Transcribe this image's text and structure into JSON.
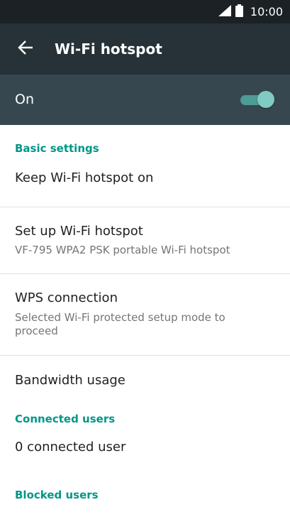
{
  "status_bar": {
    "time": "10:00",
    "icons": [
      "signal-icon",
      "battery-icon"
    ]
  },
  "app_bar": {
    "back_icon": "arrow-back-icon",
    "title": "Wi-Fi hotspot"
  },
  "master_switch": {
    "label": "On",
    "state": true
  },
  "sections": {
    "basic": {
      "header": "Basic settings",
      "keep_on": {
        "title": "Keep Wi-Fi hotspot on"
      },
      "setup": {
        "title": "Set up Wi-Fi hotspot",
        "subtitle": "VF-795 WPA2 PSK portable Wi-Fi hotspot"
      },
      "wps": {
        "title": "WPS connection",
        "subtitle": "Selected Wi-Fi protected setup mode to proceed"
      },
      "bandwidth": {
        "title": "Bandwidth usage"
      }
    },
    "connected": {
      "header": "Connected users",
      "count": {
        "title": "0 connected user"
      }
    },
    "blocked": {
      "header": "Blocked users"
    }
  },
  "colors": {
    "status_bar": "#1b2124",
    "app_bar": "#263237",
    "switch_bar": "#37474f",
    "accent": "#009688",
    "toggle_thumb": "#80cbc4"
  }
}
